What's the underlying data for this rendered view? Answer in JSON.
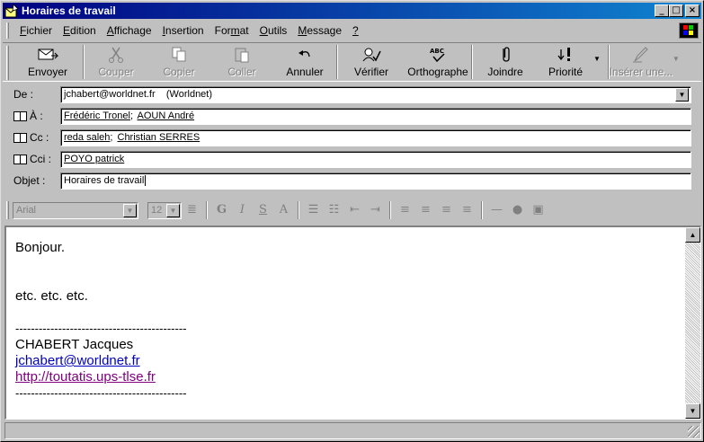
{
  "window": {
    "title": "Horaires de travail",
    "minimize": "_",
    "maximize": "□",
    "close": "×"
  },
  "menu": {
    "items": [
      {
        "label": "Fichier",
        "key": "F",
        "rest": "ichier"
      },
      {
        "label": "Edition",
        "key": "E",
        "rest": "dition"
      },
      {
        "label": "Affichage",
        "key": "A",
        "rest": "ffichage"
      },
      {
        "label": "Insertion",
        "key": "I",
        "rest": "nsertion"
      },
      {
        "label": "Format",
        "pre": "For",
        "key": "m",
        "rest": "at"
      },
      {
        "label": "Outils",
        "key": "O",
        "rest": "utils"
      },
      {
        "label": "Message",
        "key": "M",
        "rest": "essage"
      },
      {
        "label": "?",
        "key": "?",
        "rest": ""
      }
    ]
  },
  "toolbar": {
    "send": "Envoyer",
    "cut": "Couper",
    "copy": "Copier",
    "paste": "Coller",
    "undo": "Annuler",
    "check": "Vérifier",
    "spelling": "Orthographe",
    "attach": "Joindre",
    "priority": "Priorité",
    "insert": "Insérer une..."
  },
  "fields": {
    "from_label": "De :",
    "from_value": "jchabert@worldnet.fr    (Worldnet)",
    "to_label": "À :",
    "to_recipients": [
      "Frédéric Tronel",
      "AOUN André"
    ],
    "cc_label": "Cc :",
    "cc_recipients": [
      "reda saleh",
      "Christian SERRES"
    ],
    "bcc_label": "Cci :",
    "bcc_recipients": [
      "POYO patrick"
    ],
    "subject_label": "Objet :",
    "subject_value": "Horaires de travail"
  },
  "format": {
    "font": "Arial",
    "size": "12",
    "bold": "G",
    "italic": "I",
    "underline": "S",
    "color": "A"
  },
  "message": {
    "greeting": "Bonjour.",
    "content": "etc. etc. etc.",
    "separator1": "--------------------------------------------",
    "signature_name": "CHABERT Jacques",
    "signature_email": "jchabert@worldnet.fr",
    "signature_url": "http://toutatis.ups-tlse.fr",
    "separator2": "--------------------------------------------"
  },
  "colors": {
    "titlebar_start": "#000080",
    "titlebar_end": "#1084d0",
    "link": "#0000c0",
    "visited_link": "#800080",
    "face": "#c0c0c0"
  },
  "icons": [
    "envelope-icon",
    "scissors-icon",
    "copy-icon",
    "paste-icon",
    "undo-icon",
    "check-icon",
    "spelling-icon",
    "paperclip-icon",
    "priority-icon",
    "pen-icon",
    "address-book-icon"
  ]
}
